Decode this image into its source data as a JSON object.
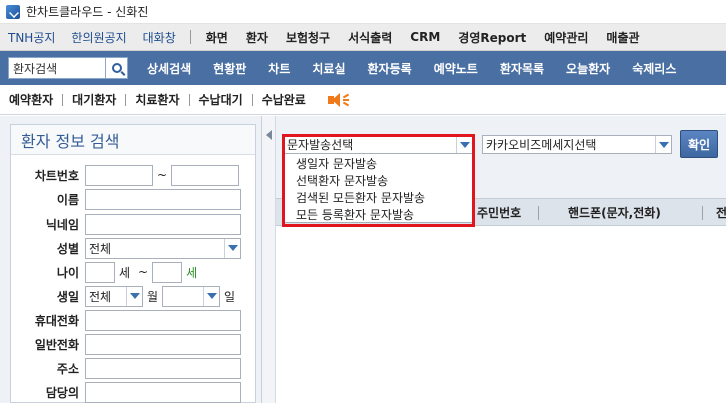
{
  "window": {
    "title": "한차트클라우드 - 신화진"
  },
  "topnav": {
    "left": [
      "TNH공지",
      "한의원공지",
      "대화창"
    ],
    "right": [
      "화면",
      "환자",
      "보험청구",
      "서식출력",
      "CRM",
      "경영Report",
      "예약관리",
      "매출관"
    ]
  },
  "menubar": {
    "search_placeholder": "환자검색",
    "items": [
      "상세검색",
      "현황판",
      "차트",
      "치료실",
      "환자등록",
      "예약노트",
      "환자목록",
      "오늘환자",
      "숙제리스"
    ]
  },
  "subbar": {
    "items": [
      "예약환자",
      "대기환자",
      "치료환자",
      "수납대기",
      "수납완료"
    ]
  },
  "left_panel": {
    "title": "환자 정보 검색",
    "labels": {
      "chart_no": "차트번호",
      "name": "이름",
      "nickname": "닉네임",
      "gender": "성별",
      "age": "나이",
      "birth": "생일",
      "mobile": "휴대전화",
      "phone": "일반전화",
      "address": "주소",
      "manager": "담당의"
    },
    "tilde": "~",
    "gender_value": "전체",
    "age_unit": "세",
    "age_unit2": "세",
    "birth_month_value": "전체",
    "birth_month_unit": "월",
    "birth_day_unit": "일"
  },
  "right_panel": {
    "sms_select": "문자발송선택",
    "sms_options": [
      "생일자 문자발송",
      "선택환자 문자발송",
      "검색된 모든환자 문자발송",
      "모든 등록환자 문자발송"
    ],
    "kakao_select": "카카오비즈메세지선택",
    "confirm_label": "확인",
    "columns": [
      "주민번호",
      "핸드폰(문자,전화)",
      "전"
    ]
  },
  "colors": {
    "menubar": "#4a6fa3",
    "highlight": "#e0151d",
    "accent": "#355d95"
  },
  "icons": [
    "app-icon",
    "search-icon",
    "speaker-icon",
    "chevron-down-icon",
    "collapse-left-icon"
  ]
}
